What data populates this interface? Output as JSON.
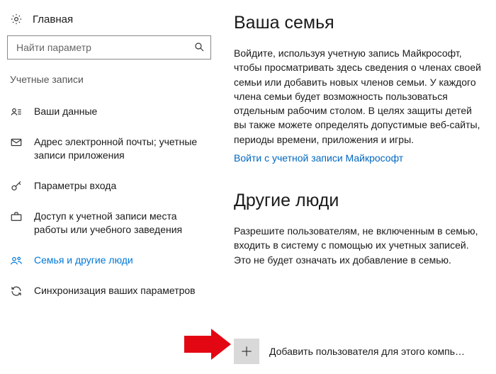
{
  "sidebar": {
    "home": "Главная",
    "search_placeholder": "Найти параметр",
    "section": "Учетные записи",
    "items": [
      {
        "label": "Ваши данные"
      },
      {
        "label": "Адрес электронной почты; учетные записи приложения"
      },
      {
        "label": "Параметры входа"
      },
      {
        "label": "Доступ к учетной записи места работы или учебного заведения"
      },
      {
        "label": "Семья и другие люди"
      },
      {
        "label": "Синхронизация ваших параметров"
      }
    ]
  },
  "content": {
    "family": {
      "heading": "Ваша семья",
      "body": "Войдите, используя учетную запись Майкрософт, чтобы просматривать здесь сведения о членах своей семьи или добавить новых членов семьи. У каждого члена семьи будет возможность пользоваться отдельным рабочим столом. В целях защиты детей вы также можете определять допустимые веб-сайты, периоды времени, приложения и игры.",
      "link": "Войти с учетной записи Майкрософт"
    },
    "other": {
      "heading": "Другие люди",
      "body": "Разрешите пользователям, не включенным в семью, входить в систему с помощью их учетных записей. Это не будет означать их добавление в семью.",
      "add_label": "Добавить пользователя для этого компь…"
    }
  }
}
